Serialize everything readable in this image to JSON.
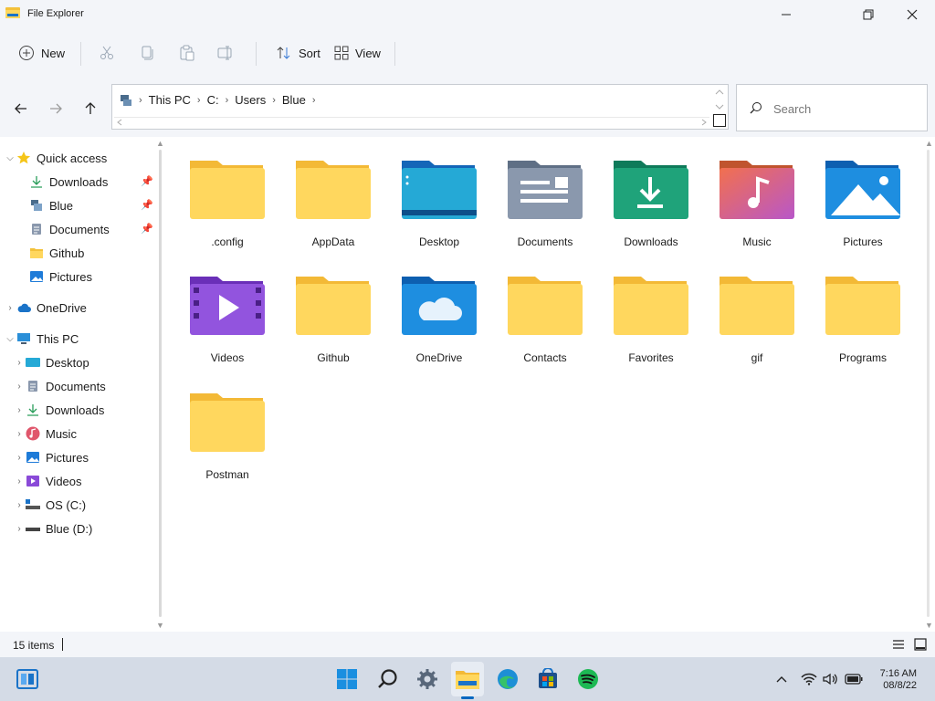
{
  "window": {
    "title": "File Explorer"
  },
  "commands": {
    "new": "New",
    "sort": "Sort",
    "view": "View"
  },
  "address": {
    "crumbs": [
      "This PC",
      "C:",
      "Users",
      "Blue"
    ]
  },
  "search": {
    "placeholder": "Search"
  },
  "sidebar": {
    "quick_access": {
      "label": "Quick access",
      "items": [
        "Downloads",
        "Blue",
        "Documents",
        "Github",
        "Pictures"
      ]
    },
    "onedrive": "OneDrive",
    "this_pc": {
      "label": "This PC",
      "items": [
        "Desktop",
        "Documents",
        "Downloads",
        "Music",
        "Pictures",
        "Videos",
        "OS (C:)",
        "Blue (D:)"
      ]
    }
  },
  "folders": [
    ".config",
    "AppData",
    "Desktop",
    "Documents",
    "Downloads",
    "Music",
    "Pictures",
    "Videos",
    "Github",
    "OneDrive",
    "Contacts",
    "Favorites",
    "gif",
    "Programs",
    "Postman"
  ],
  "status": {
    "count": "15 items"
  },
  "clock": {
    "time": "7:16 AM",
    "date": "08/8/22"
  },
  "colors": {
    "accent": "#0067c0",
    "folder": "#f8c63c",
    "background": "#ffffff"
  }
}
